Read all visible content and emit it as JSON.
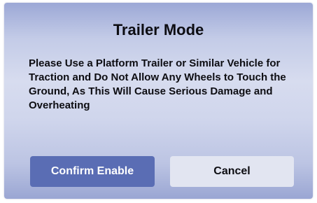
{
  "dialog": {
    "title": "Trailer Mode",
    "message": "Please Use a Platform Trailer or Similar Vehicle for Traction and Do Not Allow Any Wheels to Touch the Ground, As This Will Cause Serious Damage and Overheating",
    "confirm_label": "Confirm Enable",
    "cancel_label": "Cancel"
  },
  "colors": {
    "confirm_button": "#5a6db4",
    "cancel_button": "#e2e5f1",
    "dialog_background": "#cfd5ec"
  }
}
